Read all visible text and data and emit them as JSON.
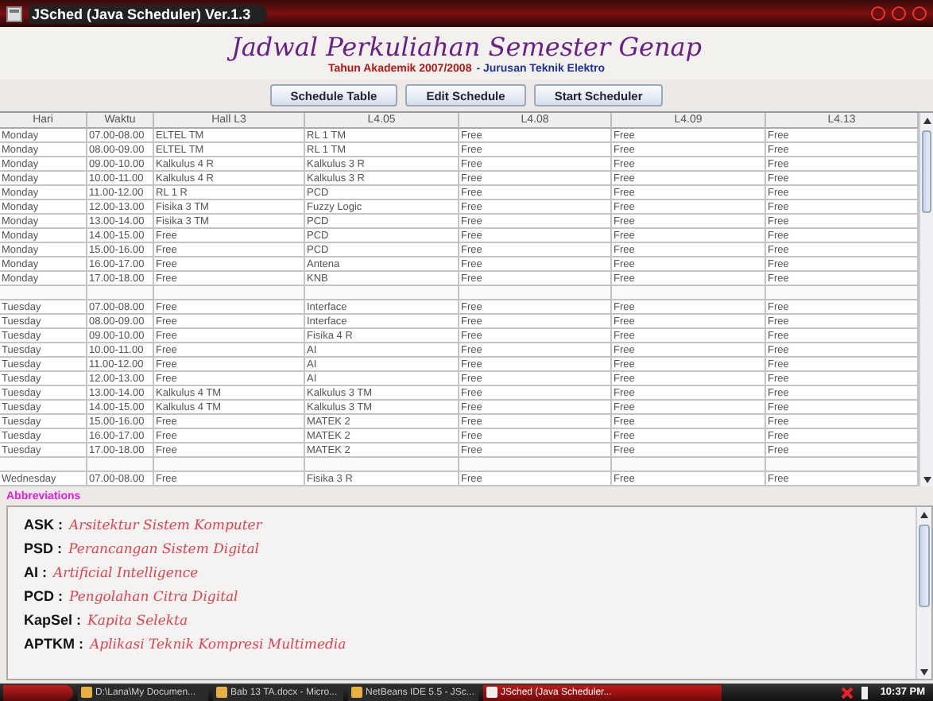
{
  "window": {
    "title": "JSched (Java Scheduler) Ver.1.3"
  },
  "header": {
    "title": "Jadwal Perkuliahan Semester Genap",
    "subtitle_left": "Tahun Akademik 2007/2008",
    "subtitle_right": "- Jurusan Teknik Elektro"
  },
  "buttons": [
    "Schedule Table",
    "Edit Schedule",
    "Start Scheduler"
  ],
  "table": {
    "columns": [
      "Hari",
      "Waktu",
      "Hall L3",
      "L4.05",
      "L4.08",
      "L4.09",
      "L4.13"
    ],
    "rows": [
      {
        "kind": "slot",
        "cells": [
          "Monday",
          "07.00-08.00",
          "ELTEL TM",
          "RL 1 TM",
          "Free",
          "Free",
          "Free"
        ]
      },
      {
        "kind": "slot",
        "cells": [
          "Monday",
          "08.00-09.00",
          "ELTEL TM",
          "RL 1 TM",
          "Free",
          "Free",
          "Free"
        ]
      },
      {
        "kind": "slot",
        "cells": [
          "Monday",
          "09.00-10.00",
          "Kalkulus 4 R",
          "Kalkulus 3 R",
          "Free",
          "Free",
          "Free"
        ]
      },
      {
        "kind": "slot",
        "cells": [
          "Monday",
          "10.00-11.00",
          "Kalkulus 4 R",
          "Kalkulus 3 R",
          "Free",
          "Free",
          "Free"
        ]
      },
      {
        "kind": "slot",
        "cells": [
          "Monday",
          "11.00-12.00",
          "RL 1 R",
          "PCD",
          "Free",
          "Free",
          "Free"
        ]
      },
      {
        "kind": "slot",
        "cells": [
          "Monday",
          "12.00-13.00",
          "Fisika 3 TM",
          "Fuzzy Logic",
          "Free",
          "Free",
          "Free"
        ]
      },
      {
        "kind": "slot",
        "cells": [
          "Monday",
          "13.00-14.00",
          "Fisika 3 TM",
          "PCD",
          "Free",
          "Free",
          "Free"
        ]
      },
      {
        "kind": "slot",
        "cells": [
          "Monday",
          "14.00-15.00",
          "Free",
          "PCD",
          "Free",
          "Free",
          "Free"
        ]
      },
      {
        "kind": "slot",
        "cells": [
          "Monday",
          "15.00-16.00",
          "Free",
          "PCD",
          "Free",
          "Free",
          "Free"
        ]
      },
      {
        "kind": "slot",
        "cells": [
          "Monday",
          "16.00-17.00",
          "Free",
          "Antena",
          "Free",
          "Free",
          "Free"
        ]
      },
      {
        "kind": "slot",
        "cells": [
          "Monday",
          "17.00-18.00",
          "Free",
          "KNB",
          "Free",
          "Free",
          "Free"
        ]
      },
      {
        "kind": "blank"
      },
      {
        "kind": "slot",
        "cells": [
          "Tuesday",
          "07.00-08.00",
          "Free",
          "Interface",
          "Free",
          "Free",
          "Free"
        ]
      },
      {
        "kind": "slot",
        "cells": [
          "Tuesday",
          "08.00-09.00",
          "Free",
          "Interface",
          "Free",
          "Free",
          "Free"
        ]
      },
      {
        "kind": "slot",
        "cells": [
          "Tuesday",
          "09.00-10.00",
          "Free",
          "Fisika 4 R",
          "Free",
          "Free",
          "Free"
        ]
      },
      {
        "kind": "slot",
        "cells": [
          "Tuesday",
          "10.00-11.00",
          "Free",
          "AI",
          "Free",
          "Free",
          "Free"
        ]
      },
      {
        "kind": "slot",
        "cells": [
          "Tuesday",
          "11.00-12.00",
          "Free",
          "AI",
          "Free",
          "Free",
          "Free"
        ]
      },
      {
        "kind": "slot",
        "cells": [
          "Tuesday",
          "12.00-13.00",
          "Free",
          "AI",
          "Free",
          "Free",
          "Free"
        ]
      },
      {
        "kind": "slot",
        "cells": [
          "Tuesday",
          "13.00-14.00",
          "Kalkulus 4 TM",
          "Kalkulus 3 TM",
          "Free",
          "Free",
          "Free"
        ]
      },
      {
        "kind": "slot",
        "cells": [
          "Tuesday",
          "14.00-15.00",
          "Kalkulus 4 TM",
          "Kalkulus 3 TM",
          "Free",
          "Free",
          "Free"
        ]
      },
      {
        "kind": "slot",
        "cells": [
          "Tuesday",
          "15.00-16.00",
          "Free",
          "MATEK 2",
          "Free",
          "Free",
          "Free"
        ]
      },
      {
        "kind": "slot",
        "cells": [
          "Tuesday",
          "16.00-17.00",
          "Free",
          "MATEK 2",
          "Free",
          "Free",
          "Free"
        ]
      },
      {
        "kind": "slot",
        "cells": [
          "Tuesday",
          "17.00-18.00",
          "Free",
          "MATEK 2",
          "Free",
          "Free",
          "Free"
        ]
      },
      {
        "kind": "blank"
      },
      {
        "kind": "slot",
        "cells": [
          "Wednesday",
          "07.00-08.00",
          "Free",
          "Fisika 3 R",
          "Free",
          "Free",
          "Free"
        ]
      }
    ]
  },
  "abbreviations": {
    "title": "Abbreviations",
    "items": [
      {
        "term": "ASK :",
        "meaning": "Arsitektur Sistem Komputer"
      },
      {
        "term": "PSD :",
        "meaning": "Perancangan Sistem Digital"
      },
      {
        "term": "AI :",
        "meaning": "Artificial Intelligence"
      },
      {
        "term": "PCD :",
        "meaning": "Pengolahan Citra Digital"
      },
      {
        "term": "KapSel :",
        "meaning": "Kapita Selekta"
      },
      {
        "term": "APTKM :",
        "meaning": "Aplikasi Teknik Kompresi Multimedia"
      }
    ]
  },
  "taskbar": {
    "tasks": [
      {
        "label": "D:\\Lana\\My Documen...",
        "selected": false
      },
      {
        "label": "Bab 13 TA.docx - Micro...",
        "selected": false
      },
      {
        "label": "NetBeans IDE 5.5 - JSc...",
        "selected": false
      },
      {
        "label": "JSched (Java Scheduler...",
        "selected": true
      }
    ],
    "clock": "10:37 PM"
  }
}
